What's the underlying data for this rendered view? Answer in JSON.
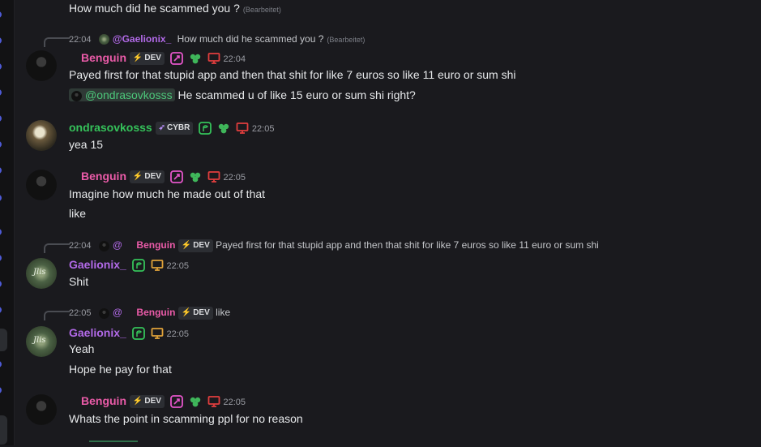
{
  "messages": {
    "m0": {
      "text": "How much did he scammed you ?",
      "edited": "(Bearbeitet)"
    },
    "m1": {
      "reply": {
        "time": "22:04",
        "name": "@Gaelionix_",
        "text": "How much did he scammed you ?",
        "edited": "(Bearbeitet)"
      },
      "author": "Benguin",
      "tag": "DEV",
      "time": "22:04",
      "lines": [
        "Payed first for that stupid app and then that shit for like 7 euros so like 11 euro or sum shi"
      ],
      "mention_line": {
        "mention": "@ondrasovkosss",
        "text": "He scammed u of like 15 euro or sum shi right?"
      }
    },
    "m2": {
      "author": "ondrasovkosss",
      "tag": "CYBR",
      "time": "22:05",
      "lines": [
        "yea 15"
      ]
    },
    "m3": {
      "author": "Benguin",
      "tag": "DEV",
      "time": "22:05",
      "lines": [
        "Imagine how much he made out of that",
        "like"
      ]
    },
    "m4": {
      "reply": {
        "time": "22:04",
        "at": "@",
        "name": "Benguin",
        "tag": "DEV",
        "text": "Payed first for that stupid app and then that shit for like 7 euros so like 11 euro or sum shi"
      },
      "author": "Gaelionix_",
      "time": "22:05",
      "lines": [
        "Shit"
      ]
    },
    "m5": {
      "reply": {
        "time": "22:05",
        "at": "@",
        "name": "Benguin",
        "tag": "DEV",
        "text": "like"
      },
      "author": "Gaelionix_",
      "time": "22:05",
      "lines": [
        "Yeah",
        "Hope he pay for that"
      ]
    },
    "m6": {
      "author": "Benguin",
      "tag": "DEV",
      "time": "22:05",
      "lines": [
        "Whats the point in scamming ppl for no reason"
      ]
    }
  },
  "colors": {
    "benguin": "#ea5ba8",
    "ondra": "#35c25a",
    "gaelionix": "#b26ae8",
    "background": "#1a1a1e"
  },
  "icons": [
    "lightning-icon",
    "rocket-icon",
    "leaf-icon",
    "monitor-icon",
    "sprout-badge-icon"
  ]
}
